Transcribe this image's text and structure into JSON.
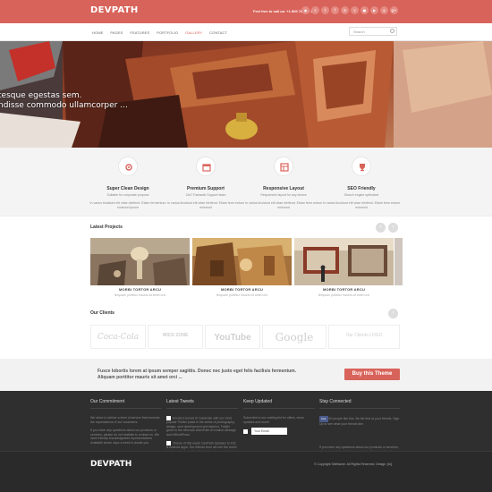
{
  "header": {
    "logo": "DEVPATH",
    "call_text": "Feel free to call us: +1 800 789 50 12",
    "social_icons": [
      "rss-icon",
      "skype-icon",
      "twitter-icon",
      "facebook-icon",
      "linkedin-icon",
      "vimeo-icon",
      "flickr-icon",
      "youtube-icon",
      "dribbble-icon",
      "googleplus-icon"
    ]
  },
  "nav": {
    "items": [
      "HOME",
      "PAGES",
      "FEATURES",
      "PORTFOLIO",
      "GALLERY",
      "CONTACT"
    ],
    "active_index": 4,
    "search_placeholder": "Search"
  },
  "hero": {
    "caption_line1": "tesque egestas sem.",
    "caption_line2": "ndisse commodo ullamcorper ..."
  },
  "features": [
    {
      "icon": "gear-icon",
      "title": "Super Clean Design",
      "subtitle": "Suitable for corporate purpose",
      "desc": "In varius tincidunt elit vitae eleifend. Etiam fermentum euismod ipsum"
    },
    {
      "icon": "calendar-icon",
      "title": "Premium Support",
      "subtitle": "24x7 Fantastic Support team",
      "desc": "In varius tincidunt elit vitae eleifend. Etiam ferm entum euismod"
    },
    {
      "icon": "layout-icon",
      "title": "Responsive Layout",
      "subtitle": "Responsive layout for any device",
      "desc": "In varius tincidunt elit vitae eleifend. Etiam ferm entum euismod"
    },
    {
      "icon": "trophy-icon",
      "title": "SEO Friendly",
      "subtitle": "Search engine optimized",
      "desc": "In varius tincidunt elit vitae eleifend. Etiam ferm entum euismod"
    }
  ],
  "projects": {
    "title": "Latest Projects",
    "items": [
      {
        "title": "MORBI TORTOR ARCU",
        "subtitle": "Nequam porttitor mauris sit amet orci"
      },
      {
        "title": "MORBI TORTOR ARCU",
        "subtitle": "Nequam porttitor mauris sit amet orci"
      },
      {
        "title": "MORBI TORTOR ARCU",
        "subtitle": "Nequam porttitor mauris sit amet orci"
      }
    ]
  },
  "clients": {
    "title": "Our Clients",
    "logos": [
      "Coca-Cola",
      "WICD ZONE",
      "YouTube",
      "Google",
      "Our Clients LOGO"
    ]
  },
  "cta": {
    "text": "Fusce lobortis lorem at ipsum semper sagittis. Donec nec justo eget felis facilisis fermentum. Aliquam porttitor mauris sit amet orci ...",
    "button": "Buy this Theme"
  },
  "footer": {
    "commitment": {
      "title": "Our Commitment",
      "text1": "We strive to deliver a level of service that exceeds the expectations of our customers.",
      "text2": "If you have any questions about our products or services, please do not hesitate to contact us. We have friendly knowledgeable representatives available seven days a week to assist you."
    },
    "tweets": {
      "title": "Latest Tweets",
      "tweet1": "Envato's turned 6! Celebrate with our most popular Twitter posts in the areas of photography, design, web development and fashion. Twitter gives to the #Envato #DevPath #Creative #Design and #WordPress",
      "tweet2": "Theme of this week: DevPath Updates to iOS & Android apps. Our friends from all over the world in choose to have friends between to your interests"
    },
    "updates": {
      "title": "Keep Updated",
      "text": "Subscribe to our mailing list for offers, news updates and more!",
      "email_placeholder": "Your Email"
    },
    "connected": {
      "title": "Stay Connected",
      "like_label": "Like",
      "like_text": "60 people like this. Be the first of your friends. Sign Up to see what your friends like.",
      "text2": "If you have any questions about our products or services, please do not hesitate to contact us. We have friendly knowledgeable representatives available seven days a week to assist you."
    },
    "logo": "DEVPATH",
    "copyright": "© Copyright SiteName. All Rights Reserved. Design: [to]"
  },
  "colors": {
    "accent": "#d8635a",
    "dark_footer": "#2f2f2f"
  }
}
